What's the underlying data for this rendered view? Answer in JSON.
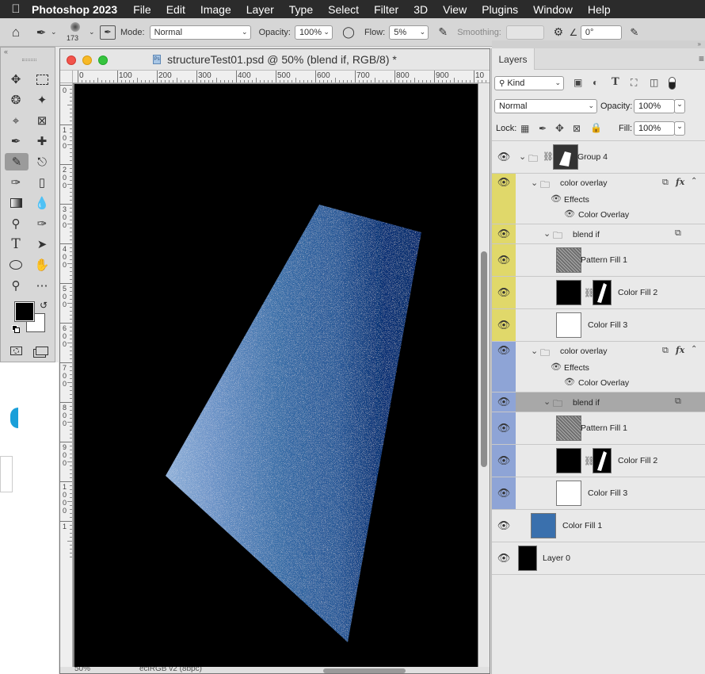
{
  "menubar": {
    "apple": "",
    "app_name": "Photoshop 2023",
    "items": [
      "File",
      "Edit",
      "Image",
      "Layer",
      "Type",
      "Select",
      "Filter",
      "3D",
      "View",
      "Plugins",
      "Window",
      "Help"
    ]
  },
  "options": {
    "brush_size": "173",
    "mode_label": "Mode:",
    "mode_value": "Normal",
    "opacity_label": "Opacity:",
    "opacity_value": "100%",
    "flow_label": "Flow:",
    "flow_value": "5%",
    "smoothing_label": "Smoothing:",
    "angle_value": "0°"
  },
  "document": {
    "title": "structureTest01.psd @ 50% (blend if, RGB/8) *",
    "zoom": "50%",
    "profile": "eciRGB v2 (8bpc)",
    "hruler_ticks": [
      "0",
      "100",
      "200",
      "300",
      "400",
      "500",
      "600",
      "700",
      "800",
      "900",
      "10"
    ],
    "vruler_ticks": [
      "0",
      "1\n0\n0",
      "2\n0\n0",
      "3\n0\n0",
      "4\n0\n0",
      "5\n0\n0",
      "6\n0\n0",
      "7\n0\n0",
      "8\n0\n0",
      "9\n0\n0",
      "1\n0\n0\n0",
      "1"
    ]
  },
  "colors": {
    "shape_light": "#8fb0d8",
    "shape_mid": "#3c6fa8",
    "shape_dark": "#0a2e6e",
    "yellow_group": "#e0d86a",
    "blue_group": "#8ea4d6"
  },
  "layers_panel": {
    "tab": "Layers",
    "filter_kind": "Kind",
    "blend_mode": "Normal",
    "opacity_label": "Opacity:",
    "opacity_value": "100%",
    "lock_label": "Lock:",
    "fill_label": "Fill:",
    "fill_value": "100%",
    "rows": [
      {
        "name": "Group 4"
      },
      {
        "name": "color overlay"
      },
      {
        "name": "Effects"
      },
      {
        "name": "Color Overlay"
      },
      {
        "name": "blend if"
      },
      {
        "name": "Pattern Fill 1"
      },
      {
        "name": "Color Fill 2"
      },
      {
        "name": "Color Fill 3"
      },
      {
        "name": "color overlay"
      },
      {
        "name": "Effects"
      },
      {
        "name": "Color Overlay"
      },
      {
        "name": "blend if"
      },
      {
        "name": "Pattern Fill 1"
      },
      {
        "name": "Color Fill 2"
      },
      {
        "name": "Color Fill 3"
      },
      {
        "name": "Color Fill 1"
      },
      {
        "name": "Layer 0"
      }
    ]
  }
}
